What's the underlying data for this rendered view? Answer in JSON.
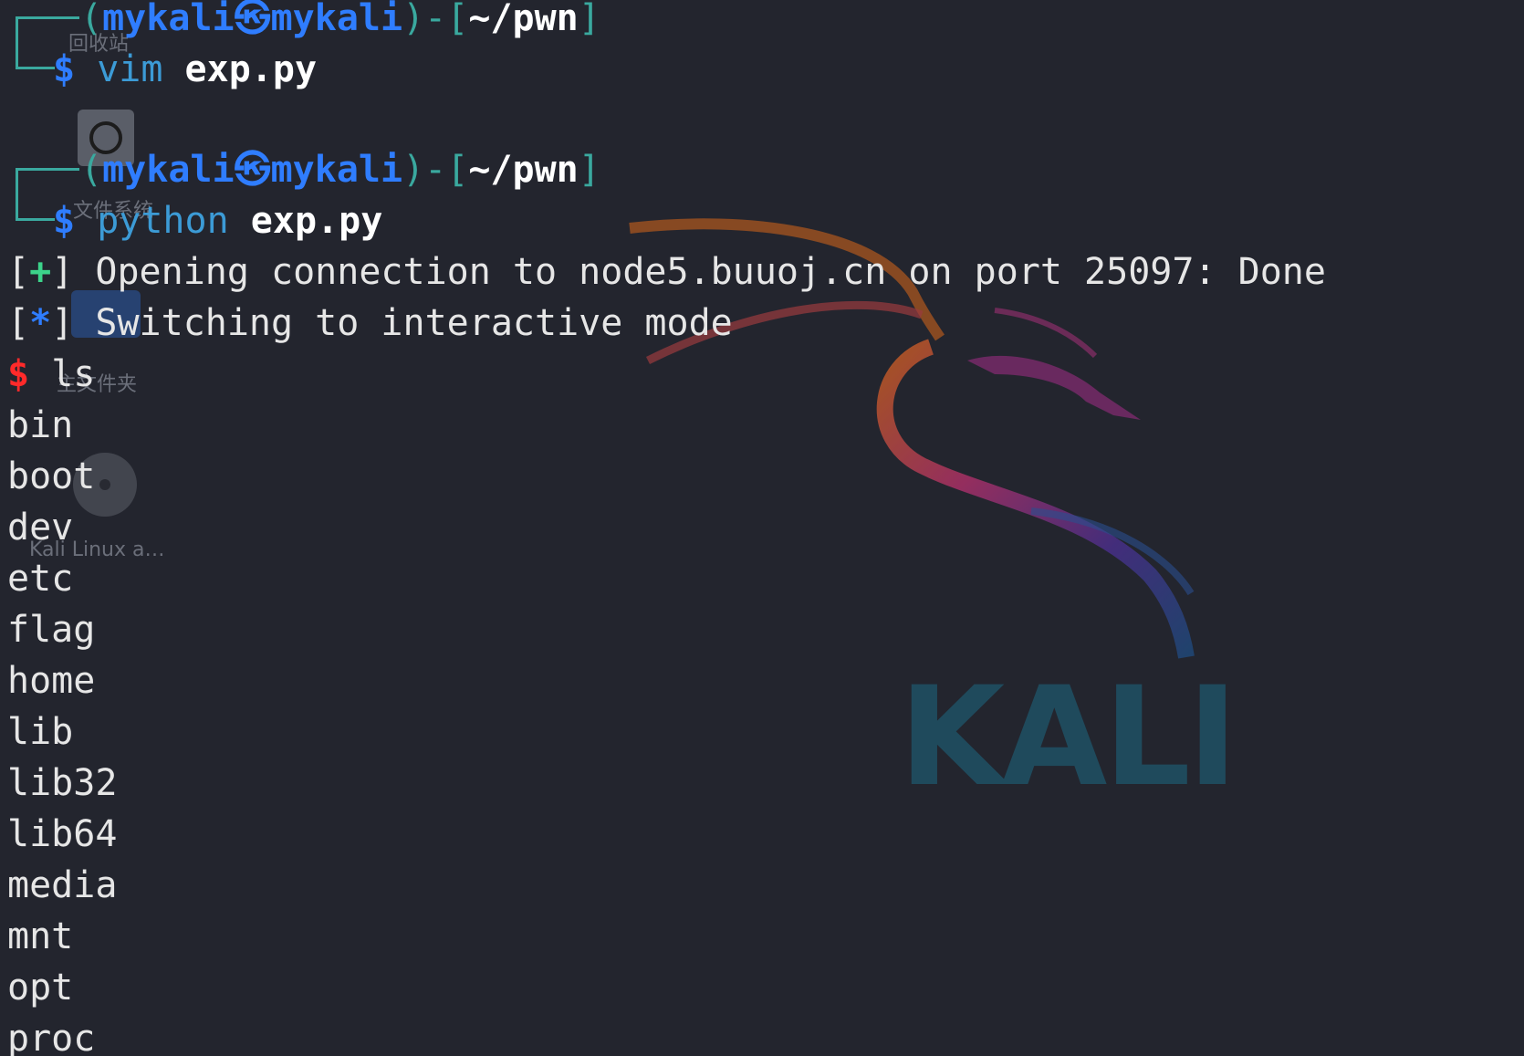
{
  "desktop": {
    "icons": [
      {
        "label": "回收站",
        "icon": "trash-icon"
      },
      {
        "label": "文件系统",
        "icon": "disk-icon"
      },
      {
        "label": "主文件夹",
        "icon": "home-folder-icon"
      },
      {
        "label": "Kali Linux a…",
        "icon": "cdrom-icon"
      }
    ],
    "wallpaper_text": "KALI"
  },
  "terminal": {
    "prompts": [
      {
        "user": "mykali",
        "host": "mykali",
        "path": "~/pwn",
        "symbol": "$",
        "command": "vim",
        "arg": "exp.py"
      },
      {
        "user": "mykali",
        "host": "mykali",
        "path": "~/pwn",
        "symbol": "$",
        "command": "python",
        "arg": "exp.py"
      }
    ],
    "output": [
      {
        "marker": "+",
        "text": "Opening connection to node5.buuoj.cn on port 25097: Done"
      },
      {
        "marker": "*",
        "text": "Switching to interactive mode"
      }
    ],
    "interactive": {
      "symbol": "$",
      "command": "ls"
    },
    "listing": [
      "bin",
      "boot",
      "dev",
      "etc",
      "flag",
      "home",
      "lib",
      "lib32",
      "lib64",
      "media",
      "mnt",
      "opt",
      "proc"
    ]
  },
  "colors": {
    "background": "#23252e",
    "prompt_user": "#2f7dff",
    "frame": "#3aa99f",
    "command": "#3c9bd6",
    "success": "#3cd38a",
    "interactive_prompt": "#ff2a2a"
  }
}
